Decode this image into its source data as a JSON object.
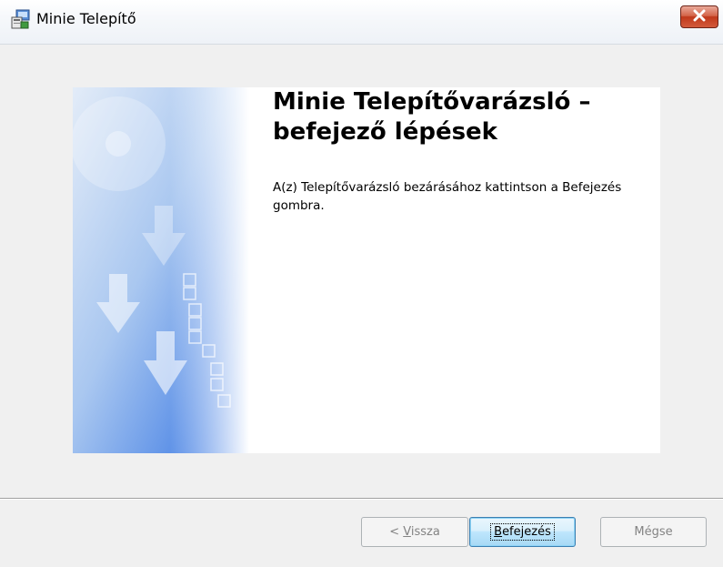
{
  "window": {
    "title": "Minie Telepítő"
  },
  "icons": {
    "app": "installer-icon",
    "close": "close-icon",
    "banner": "installer-banner-image"
  },
  "content": {
    "heading_line1": "Minie Telepítővarázsló –",
    "heading_line2": "befejező lépések",
    "description": "A(z) Telepítővarázsló bezárásához kattintson a Befejezés gombra."
  },
  "buttons": {
    "back": {
      "prefix": "< ",
      "mnemonic": "V",
      "rest": "issza",
      "enabled": false
    },
    "finish": {
      "mnemonic": "B",
      "rest": "efejezés",
      "enabled": true,
      "default": true
    },
    "cancel": {
      "label": "Mégse",
      "enabled": false
    }
  },
  "colors": {
    "close_button": "#c0391b",
    "banner_blue": "#2f6fe0",
    "default_button_border": "#3c7fb1"
  }
}
